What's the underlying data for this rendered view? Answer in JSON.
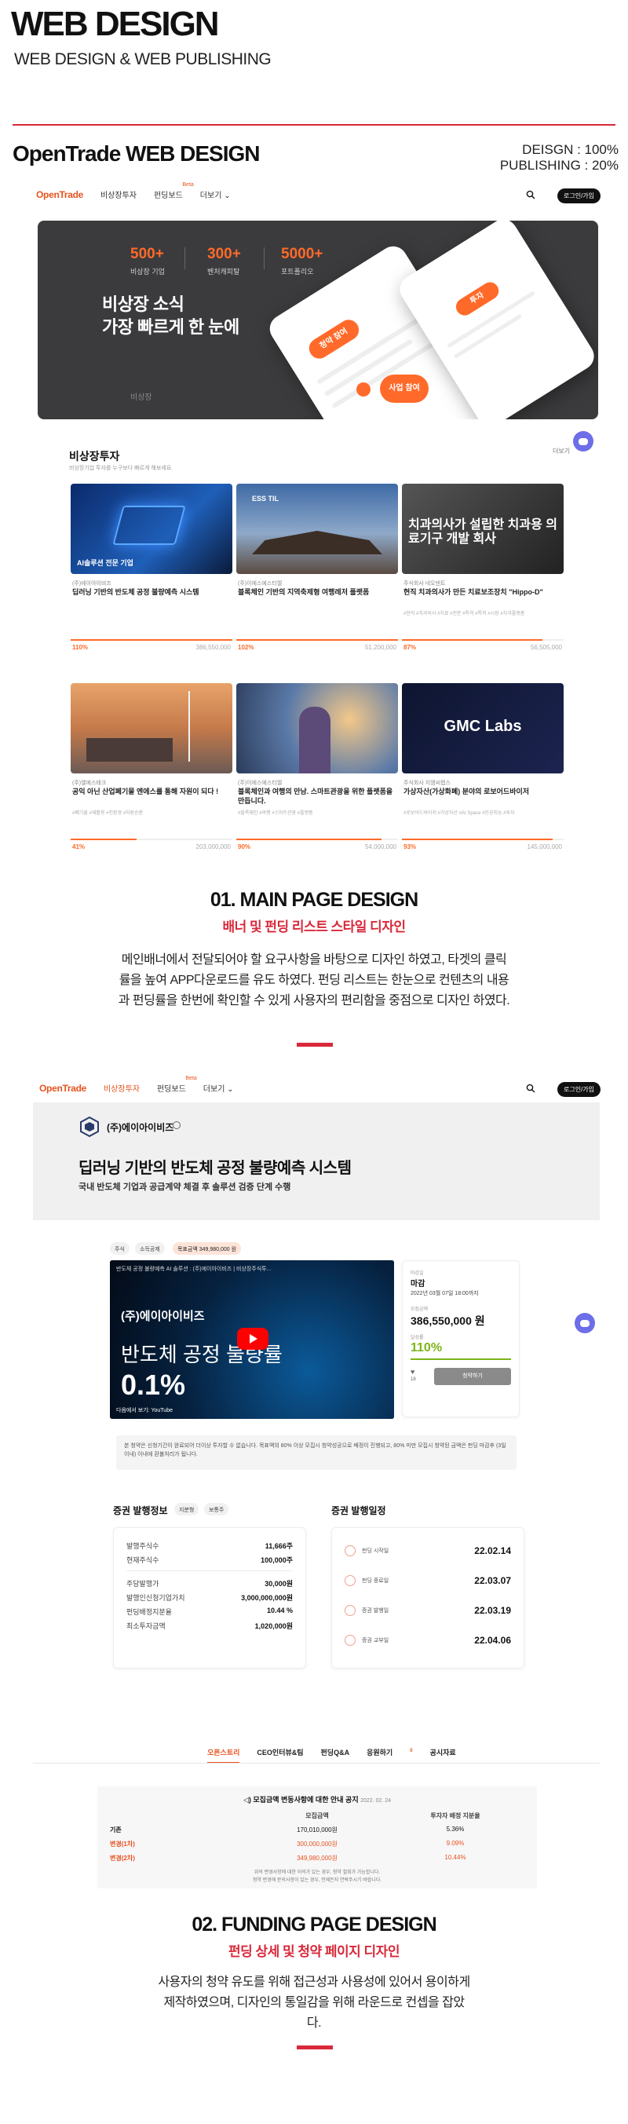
{
  "header": {
    "title": "WEB DESIGN",
    "subtitle": "WEB DESIGN & WEB PUBLISHING",
    "project_title": "OpenTrade WEB DESIGN",
    "design_ratio": "DEISGN : 100%",
    "publishing_ratio": "PUBLISHING : 20%"
  },
  "nav": {
    "logo": "OpenTrade",
    "items": [
      "비상장투자",
      "펀딩보드",
      "더보기"
    ],
    "beta": "Beta",
    "login": "로그인/가입"
  },
  "banner": {
    "stats": [
      {
        "num": "500+",
        "label": "비상장 기업"
      },
      {
        "num": "300+",
        "label": "벤처캐피탈"
      },
      {
        "num": "5000+",
        "label": "포트폴리오"
      }
    ],
    "headline_1": "비상장 소식",
    "headline_2": "가장 빠르게 한 눈에",
    "brand": "비상장",
    "phone_pill_1": "청약 참여",
    "phone_pill_2": "사업 참여",
    "phone_pill_3": "투자"
  },
  "invest": {
    "title": "비상장투자",
    "desc": "비상장기업 투자를 누구보다 빠르게 해보세요.",
    "more": "더보기",
    "cards": [
      {
        "company": "(주)에이아이비즈",
        "name": "딥러닝 기반의 반도체 공정 불량예측 시스템",
        "tags": "",
        "pct": "110%",
        "amount": "386,550,000",
        "fill": 1.0,
        "img_caption": "AI솔루션 전문 기업"
      },
      {
        "company": "(주)이에스에스티엘",
        "name": "블록체인 기반의 지역축제형 여행레저 플랫폼",
        "tags": "",
        "pct": "102%",
        "amount": "51,200,000",
        "fill": 1.0,
        "img_caption": "ESS TIL"
      },
      {
        "company": "주식회사 네오덴트",
        "name": "현직 치과의사가 만든 치료보조장치 \"Hippo-D\"",
        "tags": "#현직 #치과의사 #치료 #전문 #특허 #특허 #시장 #치과플랫폼",
        "pct": "87%",
        "amount": "56,505,000",
        "fill": 0.87,
        "img_caption": "치과의사가 설립한 치과용 의료기구 개발 회사"
      },
      {
        "company": "(주)엘에스테크",
        "name": "공익 아닌 산업폐기물 엔에스를 통해 자원이 되다 !",
        "tags": "#폐기물 #재활용 #친환경 #자원순환",
        "pct": "41%",
        "amount": "203,000,000",
        "fill": 0.41,
        "img_caption": ""
      },
      {
        "company": "(주)이에스에스티엘",
        "name": "블록체인과 여행의 만남. 스마트관광을 위한 플랫폼을 만듭니다.",
        "tags": "#블록체인 #여행 #스마트관광 #플랫폼",
        "pct": "90%",
        "amount": "54,000,000",
        "fill": 0.9,
        "img_caption": ""
      },
      {
        "company": "주식회사 지엠씨랩스",
        "name": "가상자산(가상화폐) 분야의 로보어드바이저",
        "tags": "#로보어드바이저 #가상자산 #AI Space #인공지능 #투자",
        "pct": "93%",
        "amount": "145,000,000",
        "fill": 0.93,
        "img_caption": "GMC Labs"
      }
    ]
  },
  "section1": {
    "heading": "01. MAIN PAGE DESIGN",
    "sub": "배너 및 펀딩 리스트 스타일 디자인",
    "body": "메인배너에서 전달되어야 할 요구사항을 바탕으로 디자인 하였고, 타겟의 클릭률을 높여 APP다운로드를 유도 하였다. 펀딩 리스트는 한눈으로 컨텐츠의 내용과 펀딩률을 한번에 확인할 수 있게 사용자의 편리함을 중점으로 디자인 하였다."
  },
  "funding": {
    "company": "(주)에이아이비즈",
    "title": "딥러닝 기반의 반도체 공정 불량예측 시스템",
    "desc": "국내 반도체 기업과 공급계약 체결 후 솔루션 검증 단계 수행",
    "chips": [
      "주식",
      "소득공제",
      "목표금액 349,980,000 원"
    ],
    "video_title": "반도체 공정 불량예측 AI 솔루션 : (주)에이아이비즈 | 비상장주식투...",
    "video_overlay_company": "(주)에이아이비즈",
    "video_overlay_text": "반도체 공정 불량률",
    "video_overlay_pct": "0.1%",
    "video_footer": "다음에서 보기: YouTube",
    "info": {
      "status_label": "마감일",
      "status": "마감",
      "date": "2022년 03월 07일 18:00까지",
      "amount_label": "모집금액",
      "amount": "386,550,000 원",
      "rate_label": "달성률",
      "rate": "110%",
      "count": "18",
      "button": "청약하기"
    },
    "notice": "본 청약은 신청기간이 완료되어 더이상 투자할 수 없습니다. 목표액의 80% 이상 모집시 청약성공으로 배정이 진행되고, 80% 미만 모집시 청약된 금액은 펀딩 마감후 (3일이내) 이내에 환불처리가 됩니다.",
    "issue_title": "증권 발행정보",
    "issue_tags": [
      "지분형",
      "보통주"
    ],
    "issue_rows": [
      {
        "label": "발행주식수",
        "value": "11,666주"
      },
      {
        "label": "현재주식수",
        "value": "100,000주"
      },
      {
        "label": "주당발행가",
        "value": "30,000원"
      },
      {
        "label": "발행인신청기업가치",
        "value": "3,000,000,000원"
      },
      {
        "label": "펀딩배정지분율",
        "value": "10.44 %"
      },
      {
        "label": "최소투자금액",
        "value": "1,020,000원"
      }
    ],
    "schedule_title": "증권 발행일정",
    "schedule": [
      {
        "label": "펀딩 시작일",
        "value": "22.02.14"
      },
      {
        "label": "펀딩 종료일",
        "value": "22.03.07"
      },
      {
        "label": "증권 발행일",
        "value": "22.03.19"
      },
      {
        "label": "증권 교부일",
        "value": "22.04.06"
      }
    ],
    "tabs": [
      "오픈스토리",
      "CEO인터뷰&팀",
      "펀딩Q&A",
      "응원하기",
      "공시자료"
    ],
    "tab_badge": "0",
    "table_title": "모집금액 변동사항에 대한 안내 공지",
    "table_date": "2022. 02. 24",
    "table_headers": [
      "",
      "모집금액",
      "투자자 배정 지분율"
    ],
    "table_rows": [
      {
        "c": "기존",
        "a": "170,010,000원",
        "b": "5.36%"
      },
      {
        "c": "변경(1차)",
        "a": "300,000,000원",
        "b": "9.09%"
      },
      {
        "c": "변경(2차)",
        "a": "349,980,000원",
        "b": "10.44%"
      }
    ],
    "table_note_1": "위의 변경사항에 대한 이의가 있는 경우, 청약 철회가 가능합니다.",
    "table_note_2": "청약 변경에 문의사항이 있는 경우, 언제든지 연락주시기 바랍니다."
  },
  "section2": {
    "heading": "02. FUNDING  PAGE DESIGN",
    "sub": "펀딩 상세 및 청약 페이지 디자인",
    "body": "사용자의 청약 유도를 위해 접근성과 사용성에 있어서 용이하게 제작하였으며, 디자인의 통일감을 위해 라운드로 컨셉을 잡았다."
  },
  "colors": {
    "accent": "#d9283a",
    "brand": "#e8531f",
    "chat": "#6d6ee8"
  }
}
